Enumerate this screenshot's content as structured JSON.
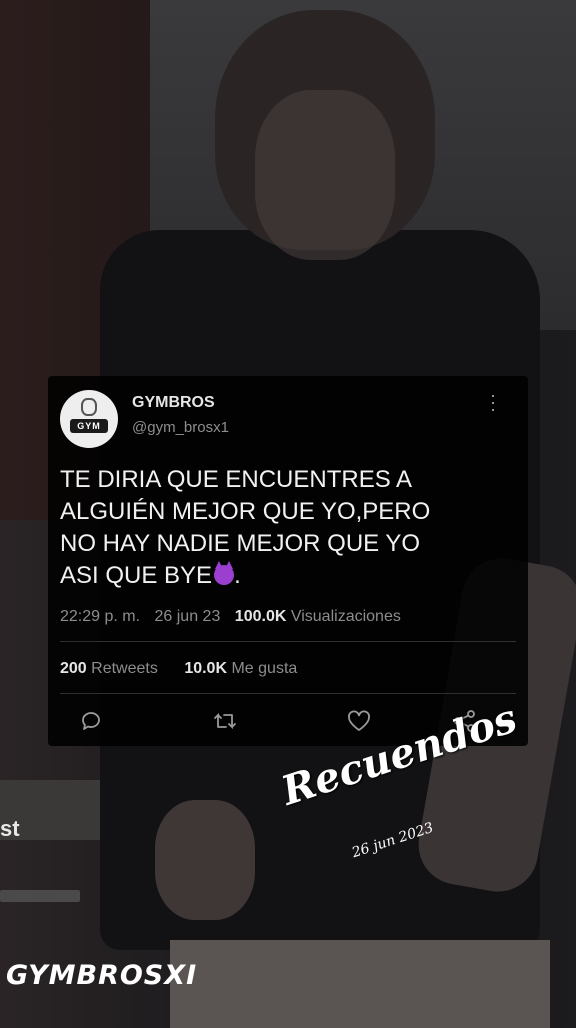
{
  "background": {
    "partial_text": "st"
  },
  "tweet": {
    "display_name": "GYMBROS",
    "handle": "@gym_brosx1",
    "avatar_badge": "GYM",
    "text_lines": [
      "TE DIRIA QUE ENCUENTRES A",
      "ALGUIÉN MEJOR QUE YO,PERO",
      "NO HAY NADIE MEJOR QUE YO",
      "ASI QUE BYE"
    ],
    "text_end": ".",
    "emoji": "smiling-devil-emoji",
    "time": "22:29 p. m.",
    "date": "26 jun 23",
    "views_count": "100.0K",
    "views_label": "Visualizaciones",
    "retweets_count": "200",
    "retweets_label": "Retweets",
    "likes_count": "10.0K",
    "likes_label": "Me gusta",
    "actions": [
      "reply-icon",
      "retweet-icon",
      "like-icon",
      "share-icon"
    ]
  },
  "overlay": {
    "title": "Recuendos",
    "date": "26 jun 2023",
    "watermark": "GYMBROSXI"
  },
  "colors": {
    "card_bg": "#000000",
    "text": "#f1f1f1",
    "muted": "#8d8d8d",
    "emoji": "#9b3fd1"
  }
}
